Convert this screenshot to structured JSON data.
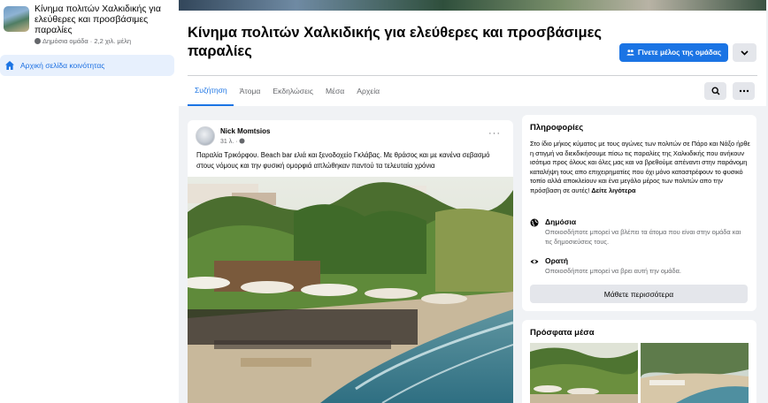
{
  "sidebar": {
    "group_name": "Κίνημα πολιτών Χαλκιδικής για ελεύθερες και προσβάσιμες παραλίες",
    "group_meta": "Δημόσια ομάδα · 2,2 χιλ. μέλη",
    "nav_item": "Αρχική σελίδα κοινότητας"
  },
  "header": {
    "title": "Κίνημα πολιτών Χαλκιδικής για ελεύθερες και προσβάσιμες παραλίες",
    "join_label": "Γίνετε μέλος της ομάδας",
    "tabs": [
      "Συζήτηση",
      "Άτομα",
      "Εκδηλώσεις",
      "Μέσα",
      "Αρχεία"
    ],
    "active_tab": "Συζήτηση"
  },
  "post": {
    "author": "Nick Momtsios",
    "time": "31 λ. ·",
    "text": "Παραλία Τρικόρφου. Beach bar ελιά και ξενοδοχείο Γκλάβας. Με θράσος και με κανένα σεβασμό στους νόμους και την φυσική ομορφιά απλώθηκαν παντού τα τελευταία χρόνια",
    "menu_glyph": "···"
  },
  "info": {
    "title": "Πληροφορίες",
    "description": "Στο ίδιο μήκος κύματος με τους αγώνες των πολιτών σε Πάρο και Νάξο ήρθε η στιγμή να διεκδικήσουμε πίσω τις παραλίες της Χαλκιδικής που ανήκουν ισότιμα προς όλους και όλες μας και να βρεθούμε απέναντι στην παράνομη καταλήψη τους απο επιχειρηματίες που όχι μόνο καταστρέφουν το φυσικό τοπίο αλλά αποκλείουν και ένα μεγάλο μέρος των πολιτών απο την πρόσβαση σε αυτές!",
    "see_more": "Δείτε λιγότερα",
    "public_title": "Δημόσια",
    "public_desc": "Οποιοσδήποτε μπορεί να βλέπει τα άτομα που είναι στην ομάδα και τις δημοσιεύσεις τους.",
    "visible_title": "Ορατή",
    "visible_desc": "Οποιοσδήποτε μπορεί να βρει αυτή την ομάδα.",
    "learn_more": "Μάθετε περισσότερα"
  },
  "media": {
    "title": "Πρόσφατα μέσα"
  },
  "colors": {
    "accent": "#1b74e4",
    "page_bg": "#f0f2f5",
    "secondary_btn": "#e4e6eb"
  },
  "icons": [
    "public-globe-icon",
    "home-icon",
    "join-group-icon",
    "chevron-down-icon",
    "search-icon",
    "more-dots-icon",
    "globe-icon",
    "eye-icon"
  ]
}
